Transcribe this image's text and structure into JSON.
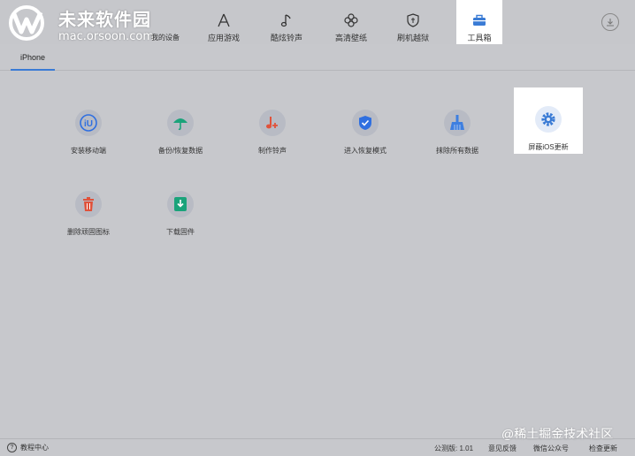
{
  "logo": {
    "text": "未来软件园",
    "url": "mac.orsoon.com",
    "partial_label": "我的设备"
  },
  "nav": {
    "items": [
      {
        "label": "应用游戏",
        "icon": "app-store-icon"
      },
      {
        "label": "酷炫铃声",
        "icon": "music-note-icon"
      },
      {
        "label": "高清壁纸",
        "icon": "flower-icon"
      },
      {
        "label": "刷机越狱",
        "icon": "shield-icon"
      },
      {
        "label": "工具箱",
        "icon": "toolbox-icon",
        "active": true
      }
    ],
    "download_icon": "download-icon"
  },
  "subtabs": [
    {
      "label": "iPhone",
      "active": true
    }
  ],
  "tools": [
    {
      "label": "安装移动端",
      "icon": "iu-app-icon",
      "color": "#2f6fe0"
    },
    {
      "label": "备份/恢复数据",
      "icon": "umbrella-icon",
      "color": "#1aa37a"
    },
    {
      "label": "制作铃声",
      "icon": "music-plus-icon",
      "color": "#e0523b"
    },
    {
      "label": "进入恢复模式",
      "icon": "shield-check-icon",
      "color": "#2f6fe0"
    },
    {
      "label": "抹除所有数据",
      "icon": "broom-icon",
      "color": "#3e7fe0"
    },
    {
      "label": "屏蔽iOS更新",
      "icon": "gear-icon",
      "color": "#3a7bd5",
      "highlighted": true
    },
    {
      "label": "删除顽固图标",
      "icon": "trash-icon",
      "color": "#e0523b"
    },
    {
      "label": "下载固件",
      "icon": "download-box-icon",
      "color": "#1aa37a"
    }
  ],
  "status": {
    "help": "教程中心",
    "version": "公测版: 1.01",
    "feedback": "意见反馈",
    "wechat": "微信公众号",
    "update": "检查更新"
  },
  "watermark": "@稀土掘金技术社区"
}
